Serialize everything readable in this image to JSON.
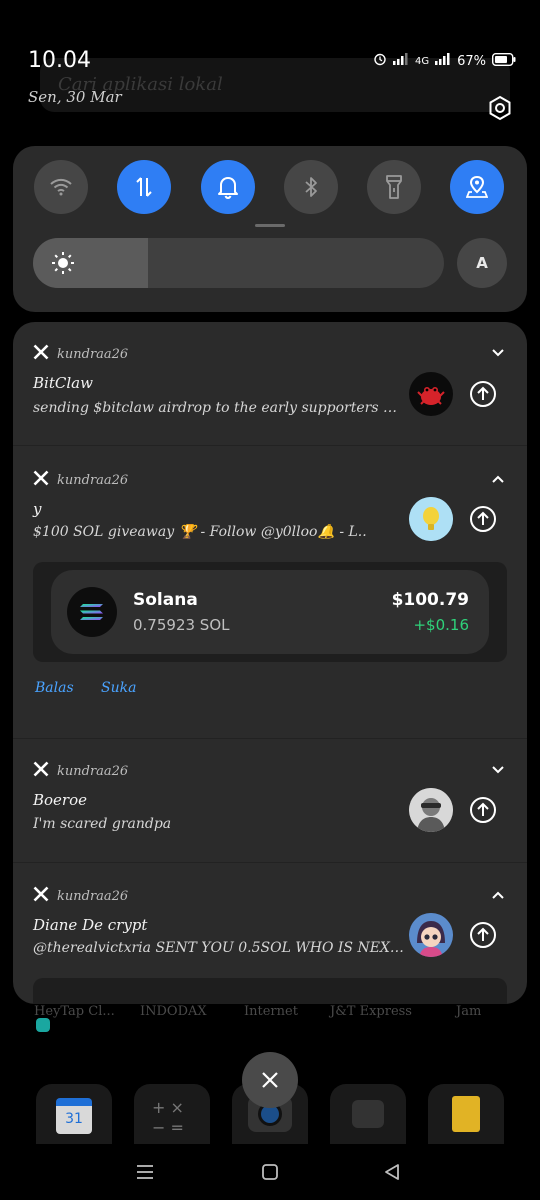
{
  "status_bar": {
    "time": "10.04",
    "date": "Sen, 30 Mar",
    "network": "4G",
    "battery": "67%"
  },
  "background": {
    "search_placeholder": "Cari aplikasi lokal",
    "app_labels": [
      "HeyTap Cl...",
      "INDODAX",
      "Internet",
      "J&T Express",
      "Jam"
    ]
  },
  "quick_settings": {
    "tiles": [
      {
        "name": "wifi",
        "on": false
      },
      {
        "name": "mobile-data",
        "on": true
      },
      {
        "name": "sound",
        "on": true
      },
      {
        "name": "bluetooth",
        "on": false
      },
      {
        "name": "flashlight",
        "on": false
      },
      {
        "name": "location",
        "on": true
      }
    ],
    "brightness_level": 0.28,
    "auto_label": "A"
  },
  "notifications": [
    {
      "app": "kundraa26",
      "title": "BitClaw",
      "body": "sending $bitclaw airdrop to the early supporters ⏳..",
      "expanded": false
    },
    {
      "app": "kundraa26",
      "title": "y",
      "body": "$100 SOL giveaway 🏆  - Follow @y0lloo🔔   - L..",
      "expanded": true,
      "card": {
        "token": "Solana",
        "amount": "0.75923 SOL",
        "usd": "$100.79",
        "change": "+$0.16"
      },
      "actions": [
        "Balas",
        "Suka"
      ]
    },
    {
      "app": "kundraa26",
      "title": "Boeroe",
      "body": "I'm scared grandpa",
      "expanded": false
    },
    {
      "app": "kundraa26",
      "title": "Diane De crypt",
      "body": "@therealvictxria SENT YOU 0.5SOL  WHO IS NEXT..",
      "expanded": true
    }
  ],
  "colors": {
    "accent": "#2f7ef4",
    "panel": "#2b2b2b",
    "positive": "#2fd27a",
    "link": "#4aa3ff"
  }
}
